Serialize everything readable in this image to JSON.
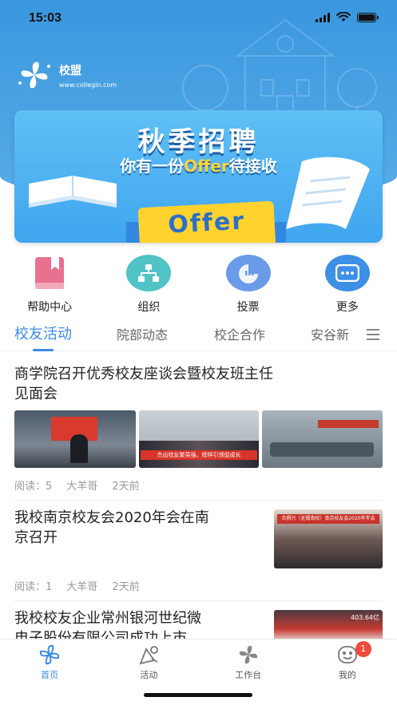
{
  "status_bar": {
    "time": "15:03"
  },
  "brand": {
    "name": "校盟",
    "url": "www.collegin.com"
  },
  "banner": {
    "title": "秋季招聘",
    "subtitle_pre": "你有一份",
    "subtitle_highlight": "Offer",
    "subtitle_post": "待接收",
    "badge": "Offer"
  },
  "quick_menu": [
    {
      "label": "帮助中心",
      "icon": "book-icon",
      "color": "#e9708f"
    },
    {
      "label": "组织",
      "icon": "org-chart-icon",
      "color": "#4fc3c6"
    },
    {
      "label": "投票",
      "icon": "vote-chart-icon",
      "color": "#6a9be8"
    },
    {
      "label": "更多",
      "icon": "more-dots-icon",
      "color": "#3e8fe6"
    }
  ],
  "tabs": [
    {
      "label": "校友活动",
      "active": true
    },
    {
      "label": "院部动态"
    },
    {
      "label": "校企合作"
    },
    {
      "label": "安谷新"
    }
  ],
  "articles": [
    {
      "title_line1": "商学院召开优秀校友座谈会暨校友班主任",
      "title_line2": "见面会",
      "reads_label": "阅读：",
      "reads": "5",
      "author": "大羊哥",
      "time": "2天前",
      "photo_banner_text": "杰出校友聚英强，榜样引领促成长"
    },
    {
      "title_line1": "我校南京校友会2020年会在南",
      "title_line2": "京召开",
      "reads_label": "阅读：",
      "reads": "1",
      "author": "大羊哥",
      "time": "2天前",
      "photo_banner_text": "合俱兴（无锡南校）南京校友会2020年年会"
    },
    {
      "title_line1": "我校校友企业常州银河世纪微",
      "title_line2": "电子股份有限公司成功上市",
      "photo_banner_text": "403.64亿"
    }
  ],
  "bottom_nav": [
    {
      "label": "首页",
      "icon": "home-pinwheel-icon",
      "active": true
    },
    {
      "label": "活动",
      "icon": "activity-icon"
    },
    {
      "label": "工作台",
      "icon": "workbench-icon"
    },
    {
      "label": "我的",
      "icon": "profile-face-icon",
      "badge": "1"
    }
  ],
  "colors": {
    "accent": "#3a8be6",
    "header": "#4aa3e6",
    "badge": "#f04b3d"
  }
}
